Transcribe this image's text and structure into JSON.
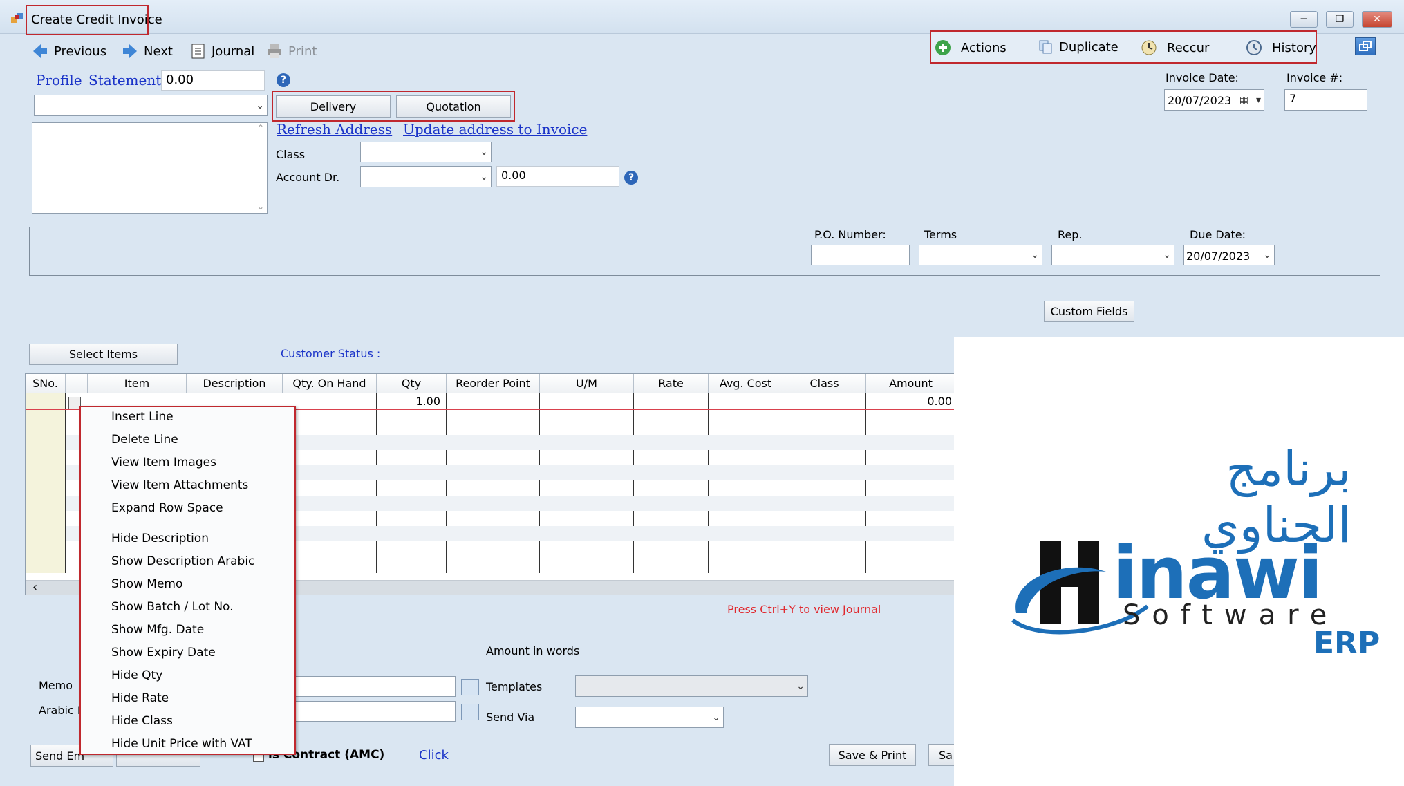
{
  "window": {
    "title": "Create Credit Invoice",
    "controls": [
      "minimize",
      "restore",
      "close"
    ]
  },
  "toolbar": {
    "previous": "Previous",
    "next": "Next",
    "journal": "Journal",
    "print": "Print"
  },
  "actions_bar": {
    "actions": "Actions",
    "duplicate": "Duplicate",
    "reccur": "Reccur",
    "history": "History"
  },
  "customer": {
    "profile": "Profile",
    "statement": "Statement",
    "statement_value": "0.00"
  },
  "buttons": {
    "delivery": "Delivery",
    "quotation": "Quotation",
    "custom_fields": "Custom Fields",
    "select_items": "Select Items",
    "save_print": "Save & Print",
    "save_partial": "Sa",
    "send_email_partial": "Send Em",
    "click": "Click"
  },
  "links": {
    "refresh_address": "Refresh Address",
    "update_address": "Update address to Invoice"
  },
  "fields": {
    "class_label": "Class",
    "account_label": "Account Dr.",
    "account_value": "0.00",
    "invoice_date_label": "Invoice Date:",
    "invoice_date": "20/07/2023",
    "invoice_no_label": "Invoice #:",
    "invoice_no": "7",
    "po_label": "P.O. Number:",
    "terms_label": "Terms",
    "rep_label": "Rep.",
    "due_date_label": "Due Date:",
    "due_date": "20/07/2023",
    "customer_status": "Customer Status :"
  },
  "grid": {
    "columns": [
      "SNo.",
      "Item",
      "Description",
      "Qty. On Hand",
      "Qty",
      "Reorder Point",
      "U/M",
      "Rate",
      "Avg. Cost",
      "Class",
      "Amount"
    ],
    "row": {
      "qty": "1.00",
      "amount": "0.00"
    }
  },
  "context_menu": {
    "group1": [
      "Insert Line",
      "Delete Line",
      "View Item Images",
      "View Item Attachments",
      "Expand Row Space"
    ],
    "group2": [
      "Hide Description",
      "Show Description Arabic",
      "Show Memo",
      "Show Batch / Lot No.",
      "Show Mfg. Date",
      "Show Expiry Date",
      "Hide Qty",
      "Hide Rate",
      "Hide Class",
      "Hide Unit Price with VAT"
    ]
  },
  "footer": {
    "journal_hint": "Press Ctrl+Y to view Journal",
    "amount_in_words": "Amount in words",
    "memo_label": "Memo",
    "arabic_label": "Arabic I",
    "templates_label": "Templates",
    "send_via_label": "Send Via",
    "amc_label": "Contract (AMC)",
    "amc_partial": "is Contract (AMC)"
  },
  "logo": {
    "arabic": "برنامج الحناوي",
    "brand": "inawi",
    "software": "Software",
    "erp": "ERP",
    "colors": {
      "blue": "#1d6fb8",
      "black": "#111111"
    }
  }
}
